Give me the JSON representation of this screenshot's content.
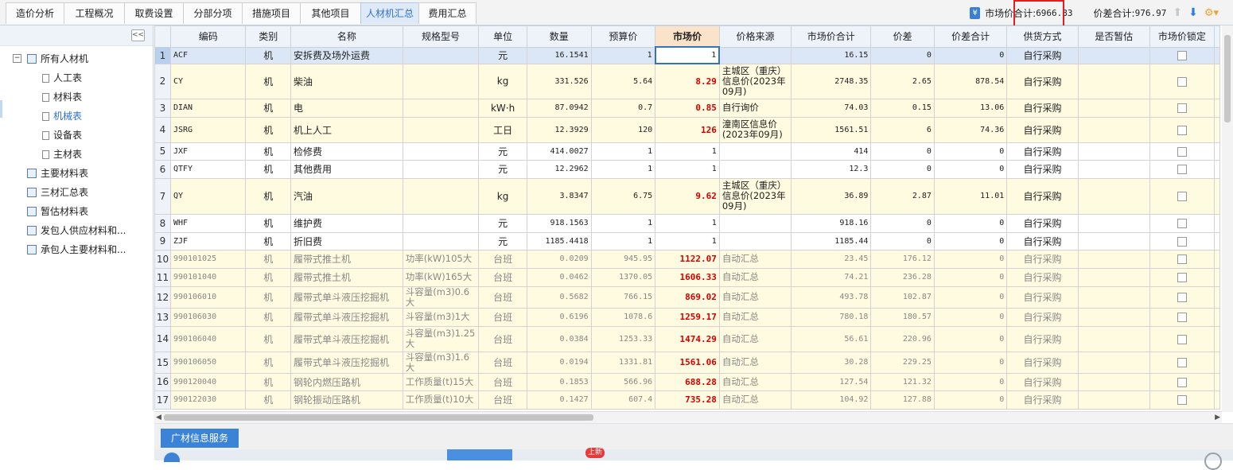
{
  "tabs": [
    "造价分析",
    "工程概况",
    "取费设置",
    "分部分项",
    "措施项目",
    "其他项目",
    "人材机汇总",
    "费用汇总"
  ],
  "active_tab": "人材机汇总",
  "summary": {
    "market_total_label": "市场价合计:",
    "market_total_value": "6966.83",
    "diff_total_label": "价差合计:",
    "diff_total_value": "976.97"
  },
  "collapse_label": "<<",
  "tree": {
    "root": "所有人材机",
    "children": [
      "人工表",
      "材料表",
      "机械表",
      "设备表",
      "主材表"
    ],
    "selected": "机械表",
    "others": [
      "主要材料表",
      "三材汇总表",
      "暂估材料表",
      "发包人供应材料和...",
      "承包人主要材料和..."
    ]
  },
  "columns": [
    "编码",
    "类别",
    "名称",
    "规格型号",
    "单位",
    "数量",
    "预算价",
    "市场价",
    "价格来源",
    "市场价合计",
    "价差",
    "价差合计",
    "供货方式",
    "是否暂估",
    "市场价锁定"
  ],
  "rows": [
    {
      "idx": "1",
      "code": "ACF",
      "type": "机",
      "name": "安拆费及场外运费",
      "spec": "",
      "unit": "元",
      "qty": "16.1541",
      "budget": "1",
      "market": "1",
      "source": "",
      "mtotal": "16.15",
      "diff": "0",
      "dtotal": "0",
      "supply": "自行采购"
    },
    {
      "idx": "2",
      "code": "CY",
      "type": "机",
      "name": "柴油",
      "spec": "",
      "unit": "kg",
      "qty": "331.526",
      "budget": "5.64",
      "market": "8.29",
      "source": "主城区（重庆）信息价(2023年09月)",
      "mtotal": "2748.35",
      "diff": "2.65",
      "dtotal": "878.54",
      "supply": "自行采购"
    },
    {
      "idx": "3",
      "code": "DIAN",
      "type": "机",
      "name": "电",
      "spec": "",
      "unit": "kW·h",
      "qty": "87.0942",
      "budget": "0.7",
      "market": "0.85",
      "source": "自行询价",
      "mtotal": "74.03",
      "diff": "0.15",
      "dtotal": "13.06",
      "supply": "自行采购"
    },
    {
      "idx": "4",
      "code": "JSRG",
      "type": "机",
      "name": "机上人工",
      "spec": "",
      "unit": "工日",
      "qty": "12.3929",
      "budget": "120",
      "market": "126",
      "source": "潼南区信息价(2023年09月)",
      "mtotal": "1561.51",
      "diff": "6",
      "dtotal": "74.36",
      "supply": "自行采购"
    },
    {
      "idx": "5",
      "code": "JXF",
      "type": "机",
      "name": "检修费",
      "spec": "",
      "unit": "元",
      "qty": "414.0027",
      "budget": "1",
      "market": "1",
      "source": "",
      "mtotal": "414",
      "diff": "0",
      "dtotal": "0",
      "supply": "自行采购"
    },
    {
      "idx": "6",
      "code": "QTFY",
      "type": "机",
      "name": "其他费用",
      "spec": "",
      "unit": "元",
      "qty": "12.2962",
      "budget": "1",
      "market": "1",
      "source": "",
      "mtotal": "12.3",
      "diff": "0",
      "dtotal": "0",
      "supply": "自行采购"
    },
    {
      "idx": "7",
      "code": "QY",
      "type": "机",
      "name": "汽油",
      "spec": "",
      "unit": "kg",
      "qty": "3.8347",
      "budget": "6.75",
      "market": "9.62",
      "source": "主城区（重庆）信息价(2023年09月)",
      "mtotal": "36.89",
      "diff": "2.87",
      "dtotal": "11.01",
      "supply": "自行采购"
    },
    {
      "idx": "8",
      "code": "WHF",
      "type": "机",
      "name": "维护费",
      "spec": "",
      "unit": "元",
      "qty": "918.1563",
      "budget": "1",
      "market": "1",
      "source": "",
      "mtotal": "918.16",
      "diff": "0",
      "dtotal": "0",
      "supply": "自行采购"
    },
    {
      "idx": "9",
      "code": "ZJF",
      "type": "机",
      "name": "折旧费",
      "spec": "",
      "unit": "元",
      "qty": "1185.4418",
      "budget": "1",
      "market": "1",
      "source": "",
      "mtotal": "1185.44",
      "diff": "0",
      "dtotal": "0",
      "supply": "自行采购"
    },
    {
      "idx": "10",
      "code": "990101025",
      "type": "机",
      "name": "履带式推土机",
      "spec": "功率(kW)105大",
      "unit": "台班",
      "qty": "0.0209",
      "budget": "945.95",
      "market": "1122.07",
      "source": "自动汇总",
      "mtotal": "23.45",
      "diff": "176.12",
      "dtotal": "0",
      "supply": "自行采购"
    },
    {
      "idx": "11",
      "code": "990101040",
      "type": "机",
      "name": "履带式推土机",
      "spec": "功率(kW)165大",
      "unit": "台班",
      "qty": "0.0462",
      "budget": "1370.05",
      "market": "1606.33",
      "source": "自动汇总",
      "mtotal": "74.21",
      "diff": "236.28",
      "dtotal": "0",
      "supply": "自行采购"
    },
    {
      "idx": "12",
      "code": "990106010",
      "type": "机",
      "name": "履带式单斗液压挖掘机",
      "spec": "斗容量(m3)0.6大",
      "unit": "台班",
      "qty": "0.5682",
      "budget": "766.15",
      "market": "869.02",
      "source": "自动汇总",
      "mtotal": "493.78",
      "diff": "102.87",
      "dtotal": "0",
      "supply": "自行采购"
    },
    {
      "idx": "13",
      "code": "990106030",
      "type": "机",
      "name": "履带式单斗液压挖掘机",
      "spec": "斗容量(m3)1大",
      "unit": "台班",
      "qty": "0.6196",
      "budget": "1078.6",
      "market": "1259.17",
      "source": "自动汇总",
      "mtotal": "780.18",
      "diff": "180.57",
      "dtotal": "0",
      "supply": "自行采购"
    },
    {
      "idx": "14",
      "code": "990106040",
      "type": "机",
      "name": "履带式单斗液压挖掘机",
      "spec": "斗容量(m3)1.25大",
      "unit": "台班",
      "qty": "0.0384",
      "budget": "1253.33",
      "market": "1474.29",
      "source": "自动汇总",
      "mtotal": "56.61",
      "diff": "220.96",
      "dtotal": "0",
      "supply": "自行采购"
    },
    {
      "idx": "15",
      "code": "990106050",
      "type": "机",
      "name": "履带式单斗液压挖掘机",
      "spec": "斗容量(m3)1.6大",
      "unit": "台班",
      "qty": "0.0194",
      "budget": "1331.81",
      "market": "1561.06",
      "source": "自动汇总",
      "mtotal": "30.28",
      "diff": "229.25",
      "dtotal": "0",
      "supply": "自行采购"
    },
    {
      "idx": "16",
      "code": "990120040",
      "type": "机",
      "name": "钢轮内燃压路机",
      "spec": "工作质量(t)15大",
      "unit": "台班",
      "qty": "0.1853",
      "budget": "566.96",
      "market": "688.28",
      "source": "自动汇总",
      "mtotal": "127.54",
      "diff": "121.32",
      "dtotal": "0",
      "supply": "自行采购"
    },
    {
      "idx": "17",
      "code": "990122030",
      "type": "机",
      "name": "钢轮振动压路机",
      "spec": "工作质量(t)10大",
      "unit": "台班",
      "qty": "0.1427",
      "budget": "607.4",
      "market": "735.28",
      "source": "自动汇总",
      "mtotal": "104.92",
      "diff": "127.88",
      "dtotal": "0",
      "supply": "自行采购"
    }
  ],
  "bottom": {
    "tab_label": "广材信息服务",
    "badge": "上新"
  }
}
